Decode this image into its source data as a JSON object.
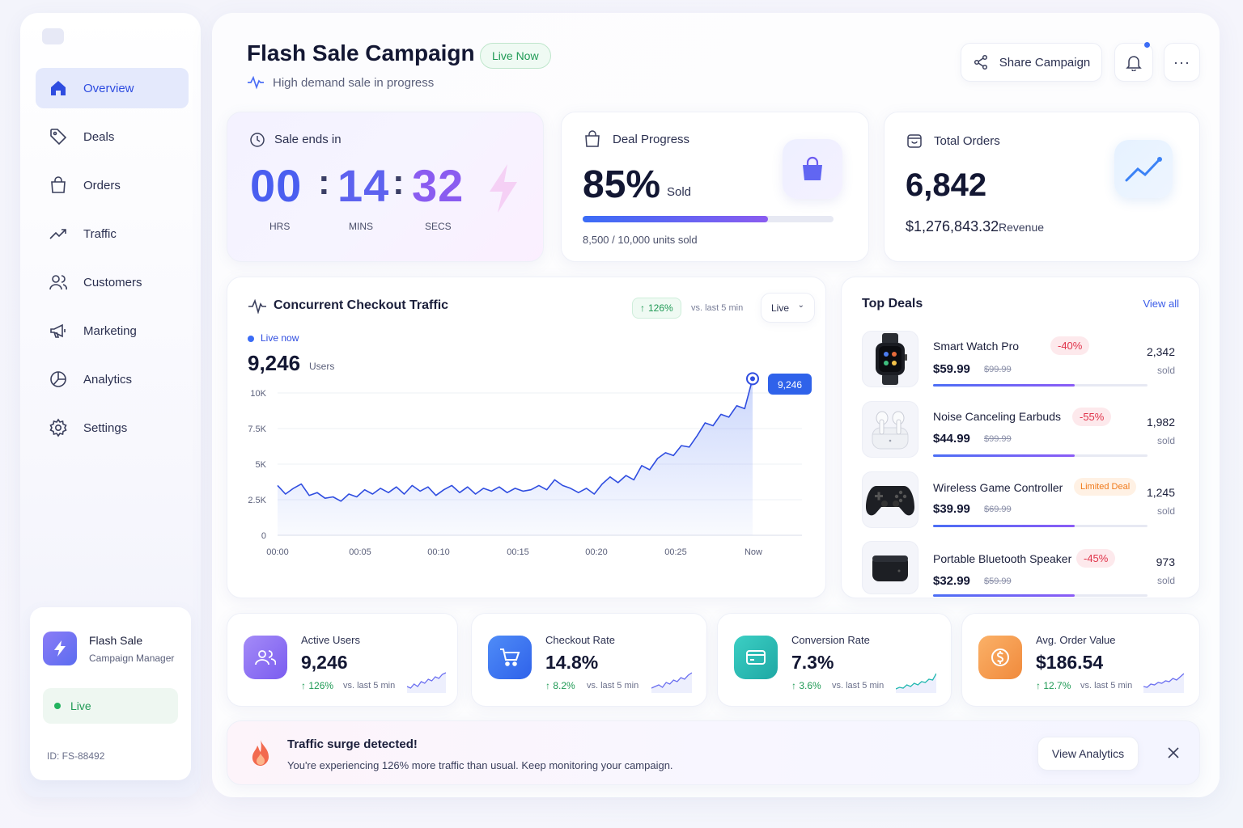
{
  "sidebar": {
    "items": [
      {
        "label": "Overview",
        "icon": "home-icon"
      },
      {
        "label": "Deals",
        "icon": "tag-icon"
      },
      {
        "label": "Orders",
        "icon": "bag-icon"
      },
      {
        "label": "Traffic",
        "icon": "trend-icon"
      },
      {
        "label": "Customers",
        "icon": "users-icon"
      },
      {
        "label": "Marketing",
        "icon": "megaphone-icon"
      },
      {
        "label": "Analytics",
        "icon": "pie-icon"
      },
      {
        "label": "Settings",
        "icon": "gear-icon"
      }
    ],
    "active": "Overview",
    "card": {
      "title": "Flash Sale",
      "subtitle": "Campaign Manager",
      "status": "Live",
      "id": "ID: FS-88492"
    }
  },
  "header": {
    "title": "Flash Sale Campaign",
    "badge": "Live Now",
    "subtitle": "High demand sale in progress",
    "share_label": "Share Campaign",
    "more_label": "···"
  },
  "timer": {
    "label": "Sale ends in",
    "hours": "00",
    "minutes": "14",
    "seconds": "32",
    "sep": ":",
    "hours_label": "HRS",
    "minutes_label": "MINS",
    "seconds_label": "SECS"
  },
  "deal_progress": {
    "label": "Deal Progress",
    "value": "85%",
    "suffix": "Sold",
    "progress": 0.74,
    "detail": "8,500 / 10,000 units sold"
  },
  "total_orders": {
    "label": "Total Orders",
    "value": "6,842",
    "revenue": "$1,276,843.32",
    "revenue_label": "Revenue"
  },
  "traffic": {
    "title": "Concurrent Checkout Traffic",
    "change": "126%",
    "change_label": "vs. last 5 min",
    "select": "Live",
    "live_label": "Live now",
    "value": "9,246",
    "unit": "Users",
    "tooltip": "9,246"
  },
  "chart_data": {
    "type": "area",
    "title": "",
    "xlabel": "",
    "ylabel": "",
    "x_ticks": [
      "00:00",
      "00:05",
      "00:10",
      "00:15",
      "00:20",
      "00:25",
      "Now"
    ],
    "y_ticks": [
      "0",
      "2.5K",
      "5K",
      "7.5K",
      "10K"
    ],
    "ylim": [
      0,
      10000
    ],
    "xlim": [
      0,
      30
    ],
    "grid": true,
    "series": [
      {
        "color": "#2f4de0",
        "x": [
          0,
          0.5,
          1,
          1.5,
          2,
          2.5,
          3,
          3.5,
          4,
          4.5,
          5,
          5.5,
          6,
          6.5,
          7,
          7.5,
          8,
          8.5,
          9,
          9.5,
          10,
          10.5,
          11,
          11.5,
          12,
          12.5,
          13,
          13.5,
          14,
          14.5,
          15,
          15.5,
          16,
          16.5,
          17,
          17.5,
          18,
          18.5,
          19,
          19.5,
          20,
          20.5,
          21,
          21.5,
          22,
          22.5,
          23,
          23.5,
          24,
          24.5,
          25,
          25.5,
          26,
          26.5,
          27,
          27.5,
          28,
          28.5,
          29,
          29.5,
          30
        ],
        "y": [
          3500,
          2900,
          3300,
          3600,
          2800,
          3000,
          2600,
          2700,
          2400,
          2900,
          2700,
          3200,
          2900,
          3300,
          3000,
          3400,
          2900,
          3500,
          3100,
          3400,
          2800,
          3200,
          3500,
          3000,
          3400,
          2900,
          3300,
          3100,
          3400,
          3000,
          3300,
          3100,
          3200,
          3500,
          3200,
          3900,
          3500,
          3300,
          3000,
          3300,
          2900,
          3600,
          4100,
          3700,
          4200,
          3900,
          4900,
          4600,
          5400,
          5800,
          5600,
          6300,
          6200,
          7000,
          7900,
          7700,
          8500,
          8300,
          9100,
          8900,
          11000
        ]
      }
    ],
    "highlight": {
      "x": 30,
      "y": 11000,
      "label": "9,246"
    }
  },
  "top_deals": {
    "title": "Top Deals",
    "view_all": "View all",
    "items": [
      {
        "name": "Smart Watch Pro",
        "price": "$59.99",
        "old_price": "$99.99",
        "badge": "-40%",
        "badge_type": "red",
        "sold": "2,342",
        "sold_label": "sold",
        "progress": 0.66
      },
      {
        "name": "Noise Canceling Earbuds",
        "price": "$44.99",
        "old_price": "$99.99",
        "badge": "-55%",
        "badge_type": "red",
        "sold": "1,982",
        "sold_label": "sold",
        "progress": 0.66
      },
      {
        "name": "Wireless Game Controller",
        "price": "$39.99",
        "old_price": "$69.99",
        "badge": "Limited Deal",
        "badge_type": "orange",
        "sold": "1,245",
        "sold_label": "sold",
        "progress": 0.66
      },
      {
        "name": "Portable Bluetooth Speaker",
        "price": "$32.99",
        "old_price": "$59.99",
        "badge": "-45%",
        "badge_type": "red",
        "sold": "973",
        "sold_label": "sold",
        "progress": 0.66
      }
    ]
  },
  "stats": [
    {
      "label": "Active Users",
      "value": "9,246",
      "change": "126%",
      "change_label": "vs. last 5 min",
      "color": "#8b6cf6"
    },
    {
      "label": "Checkout Rate",
      "value": "14.8%",
      "change": "8.2%",
      "change_label": "vs. last 5 min",
      "color": "#3b7cf6"
    },
    {
      "label": "Conversion Rate",
      "value": "7.3%",
      "change": "3.6%",
      "change_label": "vs. last 5 min",
      "color": "#22b8b0"
    },
    {
      "label": "Avg. Order Value",
      "value": "$186.54",
      "change": "12.7%",
      "change_label": "vs. last 5 min",
      "color": "#f39a4c"
    }
  ],
  "alert": {
    "title": "Traffic surge detected!",
    "message": "You're experiencing 126% more traffic than usual. Keep monitoring your campaign.",
    "button": "View Analytics"
  }
}
